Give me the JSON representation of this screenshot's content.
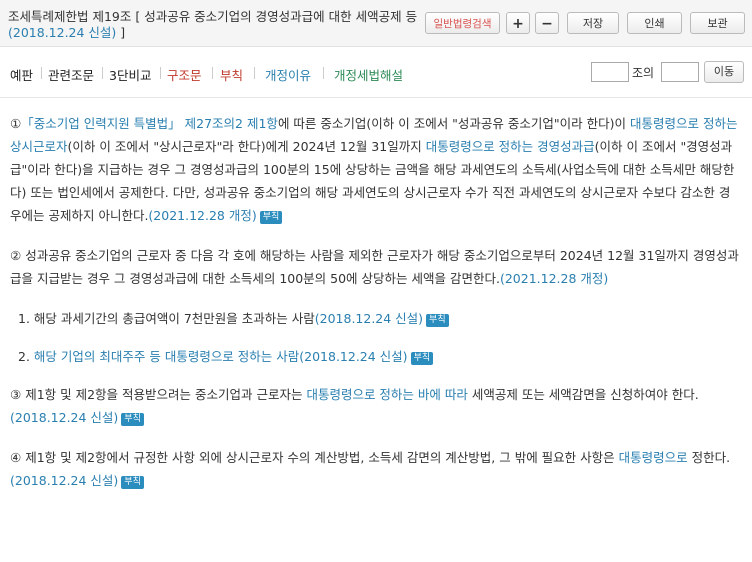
{
  "header": {
    "title_main": "조세특례제한법 제19조 [ 성과공유 중소기업의 경영성과급에 대한 세액공제 등",
    "title_date": "(2018.12.24 신설)",
    "title_end": " ]",
    "buttons": {
      "search": "일반법령검색",
      "plus": "+",
      "minus": "−",
      "save": "저장",
      "print": "인쇄",
      "keep": "보관"
    }
  },
  "toolbar": {
    "tabs": [
      "예판",
      "관련조문",
      "3단비교",
      "구조문",
      "부칙",
      "개정이유",
      "개정세법해설"
    ],
    "jo_label": "조의",
    "move_label": "이동"
  },
  "content": {
    "badge": "부칙",
    "p1": {
      "num": "①",
      "link1": "「중소기업 인력지원 특별법」 제27조의2 제1항",
      "t1": "에 따른 중소기업(이하 이 조에서 \"성과공유 중소기업\"이라 한다)이 ",
      "link2": "대통령령으로 정하는 상시근로자",
      "t2": "(이하 이 조에서 \"상시근로자\"라 한다)에게 2024년 12월 31일까지 ",
      "link3": "대통령령으로 정하는 경영성과급",
      "t3": "(이하 이 조에서 \"경영성과급\"이라 한다)을 지급하는 경우 그 경영성과급의 100분의 15에 상당하는 금액을 해당 과세연도의 소득세(사업소득에 대한 소득세만 해당한다) 또는 법인세에서 공제한다. 다만, 성과공유 중소기업의 해당 과세연도의 상시근로자 수가 직전 과세연도의 상시근로자 수보다 감소한 경우에는 공제하지 아니한다.",
      "rev": "(2021.12.28 개정)"
    },
    "p2": {
      "num": "②",
      "t1": "성과공유 중소기업의 근로자 중 다음 각 호에 해당하는 사람을 제외한 근로자가 해당 중소기업으로부터 2024년 12월 31일까지 경영성과급을 지급받는 경우 그 경영성과급에 대한 소득세의 100분의 50에 상당하는 세액을 감면한다.",
      "rev": "(2021.12.28 개정)"
    },
    "item1": {
      "num": "1.",
      "t1": "해당 과세기간의 총급여액이 7천만원을 초과하는 사람",
      "rev": "(2018.12.24 신설)"
    },
    "item2": {
      "num": "2.",
      "link1": "해당 기업의 최대주주 등 대통령령으로 정하는 사람",
      "rev": "(2018.12.24 신설)"
    },
    "p3": {
      "num": "③",
      "t1": "제1항 및 제2항을 적용받으려는 중소기업과 근로자는 ",
      "link1": "대통령령으로 정하는 바에 따라",
      "t2": " 세액공제 또는 세액감면을 신청하여야 한다.",
      "rev": "(2018.12.24 신설)"
    },
    "p4": {
      "num": "④",
      "t1": "제1항 및 제2항에서 규정한 사항 외에 상시근로자 수의 계산방법, 소득세 감면의 계산방법, 그 밖에 필요한 사항은 ",
      "link1": "대통령령으로",
      "t2": " 정한다.",
      "rev": "(2018.12.24 신설)"
    }
  }
}
